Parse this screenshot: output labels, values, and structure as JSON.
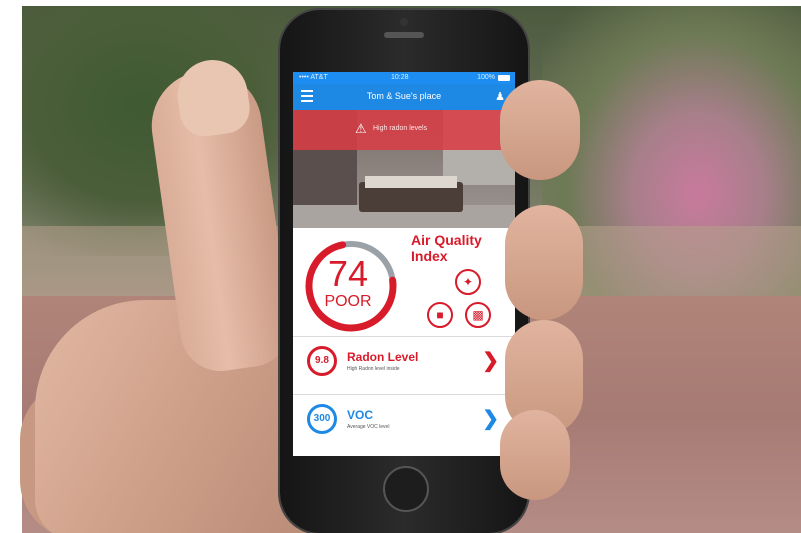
{
  "colors": {
    "accent_red": "#d81b2a",
    "accent_blue": "#1e88e5",
    "banner": "#d83e46"
  },
  "statusbar": {
    "carrier": "•••• AT&T",
    "time": "10:28",
    "battery": "100%"
  },
  "header": {
    "title": "Tom & Sue's place",
    "menu_icon": "hamburger-menu-icon",
    "profile_icon": "person-icon"
  },
  "alert": {
    "text": "High radon levels",
    "icon": "warning-icon"
  },
  "aqi": {
    "value": "74",
    "rating": "POOR",
    "title": "Air Quality Index",
    "gauge_level": 0.74,
    "buttons": [
      "pin-icon",
      "info-icon",
      "chart-icon"
    ]
  },
  "metrics": [
    {
      "badge": "9.8",
      "name": "Radon Level",
      "sub": "High Radon level inside",
      "icon": "chevron-right-icon"
    },
    {
      "badge": "300",
      "name": "VOC",
      "sub": "Average VOC level",
      "icon": "chevron-right-icon"
    }
  ]
}
